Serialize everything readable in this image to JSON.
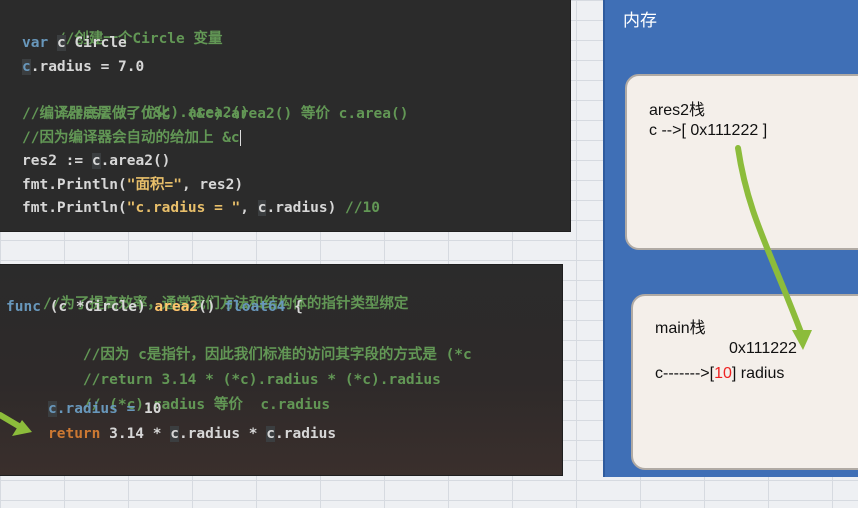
{
  "code_top": {
    "line1": "//创建一个Circle 变量",
    "line2_kw": "var",
    "line2_var": "c",
    "line2_type": "Circle",
    "line3_var": "c",
    "line3_rest": ".radius = 7.0",
    "line4": "//res2 := (&c).area2()",
    "line5_a": "//编译器底层做了优化  (&c).area2() 等价 ",
    "line5_b": "c.area()",
    "line6": "//因为编译器会自动的给加上 &c",
    "line7_a": "res2 := ",
    "line7_b": "c",
    "line7_c": ".area2()",
    "line8_a": "fmt.Println(",
    "line8_str": "\"面积=\"",
    "line8_b": ", res2)",
    "line9_a": "fmt.Println(",
    "line9_str": "\"c.radius = \"",
    "line9_b": ", ",
    "line9_c": "c",
    "line9_d": ".radius) ",
    "line9_comment": "//10"
  },
  "code_bottom": {
    "line1": "//为了提高效率，通常我们方法和结构体的指针类型绑定",
    "line2_kw": "func",
    "line2_recv": " (c *Circle) ",
    "line2_name": "area2",
    "line2_sig": "() ",
    "line2_ret": "float64",
    "line2_brace": " {",
    "line3": "//因为 c是指针，因此我们标准的访问其字段的方式是 (*c",
    "line4": "//return 3.14 * (*c).radius * (*c).radius",
    "line5": "// (*c).radius 等价  c.radius",
    "line6_a": "c",
    "line6_b": ".radius = ",
    "line6_num": "10",
    "line7_kw": "return",
    "line7_a": " 3.14 * ",
    "line7_b": "c",
    "line7_c": ".radius * ",
    "line7_d": "c",
    "line7_e": ".radius",
    "line8": "}"
  },
  "memory": {
    "title": "内存",
    "ares2_stack": {
      "title": "ares2栈",
      "pointer_label": "c -->[ 0x111222 ]"
    },
    "main_stack": {
      "title": "main栈",
      "address": "0x111222",
      "var_prefix": "c------->[",
      "value": "10",
      "var_suffix": "] radius"
    }
  },
  "colors": {
    "memory_panel": "#3f6fb6",
    "arrow": "#8cbc3b",
    "highlight_value": "#ee2222"
  }
}
